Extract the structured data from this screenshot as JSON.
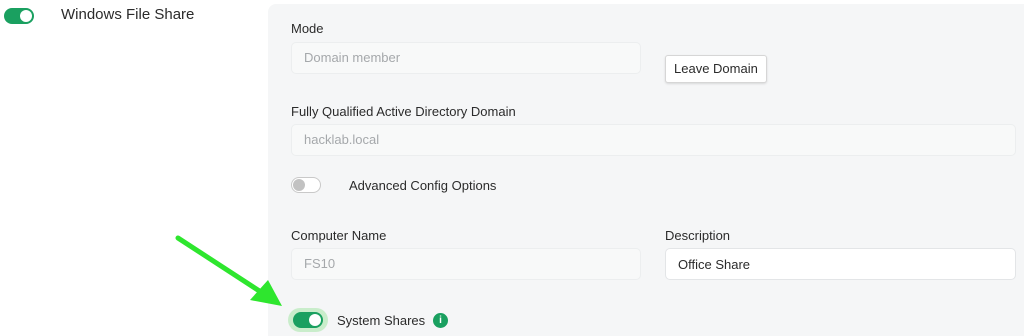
{
  "service": {
    "title": "Windows File Share",
    "enabled": true
  },
  "mode": {
    "label": "Mode",
    "value": "Domain member",
    "leave_button": "Leave Domain"
  },
  "domain": {
    "label": "Fully Qualified Active Directory Domain",
    "value": "hacklab.local"
  },
  "advanced": {
    "label": "Advanced Config Options",
    "enabled": false
  },
  "computer": {
    "label": "Computer Name",
    "value": "FS10"
  },
  "description": {
    "label": "Description",
    "value": "Office Share"
  },
  "system_shares": {
    "label": "System Shares",
    "enabled": true,
    "info_glyph": "i"
  },
  "colors": {
    "accent": "#1aa060",
    "panel_bg": "#f5f6f7",
    "annotation_arrow": "#2ee62e"
  },
  "icons": {
    "info": "info-icon",
    "annotation": "arrow-annotation-icon"
  }
}
